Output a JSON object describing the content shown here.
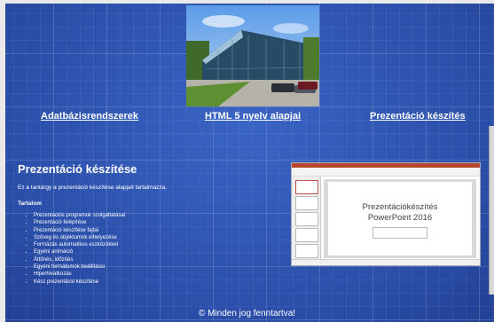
{
  "nav": {
    "link1": "Adatbázisrendszerek",
    "link2": "HTML 5 nyelv alapjai",
    "link3": "Prezentáció készítés"
  },
  "content": {
    "title": "Prezentáció készítése",
    "intro": "Ez a tantárgy a prezentáció készítése alapjait tartalmazza.",
    "section_label": "Tartalom",
    "topics": [
      "Prezentációs programok szolgáltatásai",
      "Prezentáció felépítése",
      "Prezentáció készítése fajtái",
      "Szöveg és objektumok elhelyezése",
      "Formázás automatikus eszközökkel",
      "Egyéni animáció",
      "Áttűnés, időzítés",
      "Egyéni formátumok beállítássi",
      "Hiperhivatkozás",
      "Kész prezentáció készítése"
    ]
  },
  "thumbnail": {
    "line1": "Prezentációkészítés",
    "line2": "PowerPoint 2016"
  },
  "footer": {
    "text": "© Minden jog fenntartva!"
  },
  "colors": {
    "background": "#2f55b4",
    "ribbon_accent": "#b7472a"
  }
}
